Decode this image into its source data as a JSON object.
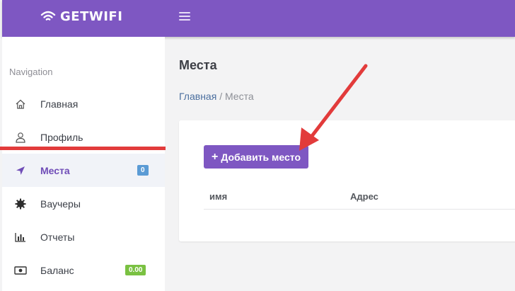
{
  "app": {
    "logo_text": "GETWIFI"
  },
  "sidebar": {
    "header": "Navigation",
    "items": [
      {
        "label": "Главная",
        "icon": "home-icon"
      },
      {
        "label": "Профиль",
        "icon": "user-icon"
      },
      {
        "label": "Места",
        "icon": "location-arrow-icon",
        "badge": "0",
        "active": true
      },
      {
        "label": "Ваучеры",
        "icon": "gear-icon"
      },
      {
        "label": "Отчеты",
        "icon": "bar-chart-icon"
      },
      {
        "label": "Баланс",
        "icon": "money-icon",
        "badge": "0.00"
      }
    ]
  },
  "main": {
    "title": "Места",
    "breadcrumb": {
      "home": "Главная",
      "separator": "/",
      "current": "Места"
    },
    "add_button": {
      "icon": "+",
      "label": "Добавить место"
    },
    "table": {
      "columns": [
        "имя",
        "Адрес"
      ]
    }
  },
  "colors": {
    "brand": "#7e57c2",
    "annotation": "#e23b3b",
    "badge_blue": "#5b9bd5",
    "badge_green": "#7ac142"
  }
}
